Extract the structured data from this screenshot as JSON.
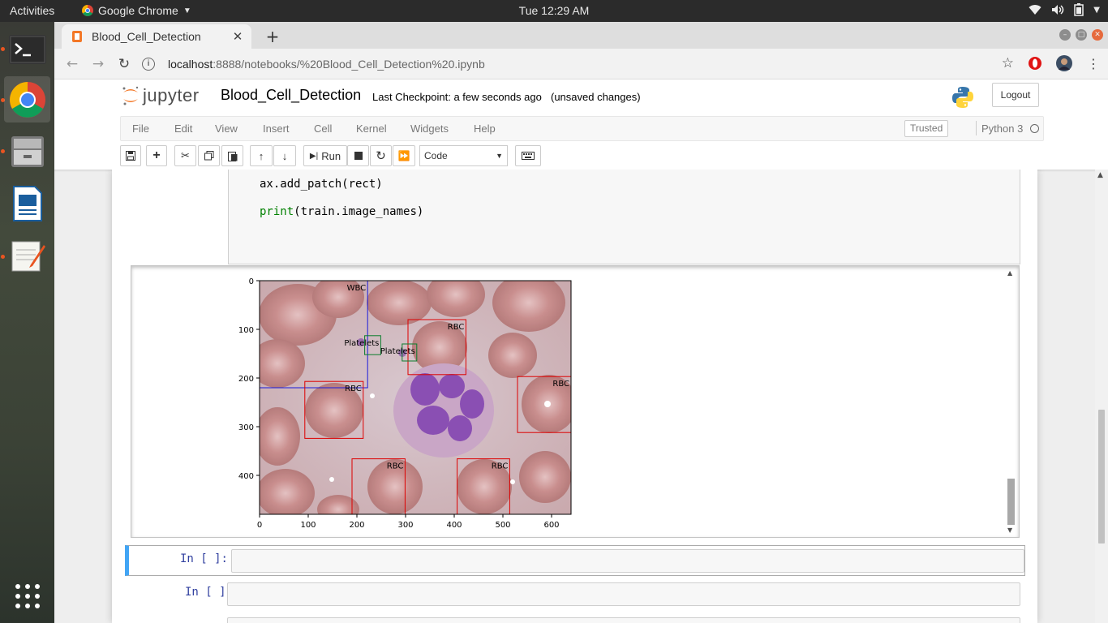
{
  "system_bar": {
    "activities": "Activities",
    "app_name": "Google Chrome",
    "clock": "Tue 12:29 AM"
  },
  "dock": {
    "items": [
      "terminal-icon",
      "chrome-icon",
      "file-manager-icon",
      "writer-icon",
      "text-editor-icon",
      "show-applications-icon"
    ]
  },
  "browser": {
    "tab_title": "Blood_Cell_Detection",
    "url_host": "localhost",
    "url_path": ":8888/notebooks/%20Blood_Cell_Detection%20.ipynb"
  },
  "jupyter": {
    "logo_text": "jupyter",
    "notebook_name": "Blood_Cell_Detection",
    "checkpoint": "Last Checkpoint: a few seconds ago",
    "unsaved": "(unsaved changes)",
    "logout_label": "Logout",
    "menu": [
      "File",
      "Edit",
      "View",
      "Insert",
      "Cell",
      "Kernel",
      "Widgets",
      "Help"
    ],
    "trusted_label": "Trusted",
    "kernel_name": "Python 3",
    "run_label": "Run",
    "cell_type": "Code"
  },
  "cells": {
    "code_lines": [
      "ax.add_patch(rect)",
      "train.image_names"
    ],
    "print_keyword": "print",
    "empty_prompts": [
      "In [ ]:",
      "In [ ]:"
    ]
  },
  "chart_data": {
    "type": "image-annotations",
    "xlim": [
      0,
      640
    ],
    "ylim": [
      480,
      0
    ],
    "xticks": [
      0,
      100,
      200,
      300,
      400,
      500,
      600
    ],
    "yticks": [
      0,
      100,
      200,
      300,
      400
    ],
    "boxes": [
      {
        "label": "WBC",
        "xmin": 0,
        "ymin": 0,
        "xmax": 222,
        "ymax": 220,
        "color": "#1a1adb"
      },
      {
        "label": "RBC",
        "xmin": 305,
        "ymin": 80,
        "xmax": 424,
        "ymax": 193,
        "color": "#dd0000"
      },
      {
        "label": "Platelets",
        "xmin": 216,
        "ymin": 113,
        "xmax": 249,
        "ymax": 152,
        "color": "#0a7d2c"
      },
      {
        "label": "Platelets",
        "xmin": 293,
        "ymin": 130,
        "xmax": 323,
        "ymax": 165,
        "color": "#0a7d2c"
      },
      {
        "label": "RBC",
        "xmin": 93,
        "ymin": 207,
        "xmax": 213,
        "ymax": 324,
        "color": "#dd0000"
      },
      {
        "label": "RBC",
        "xmin": 530,
        "ymin": 197,
        "xmax": 640,
        "ymax": 312,
        "color": "#dd0000"
      },
      {
        "label": "RBC",
        "xmin": 190,
        "ymin": 366,
        "xmax": 299,
        "ymax": 480,
        "color": "#dd0000"
      },
      {
        "label": "RBC",
        "xmin": 406,
        "ymin": 366,
        "xmax": 514,
        "ymax": 480,
        "color": "#dd0000"
      }
    ]
  }
}
